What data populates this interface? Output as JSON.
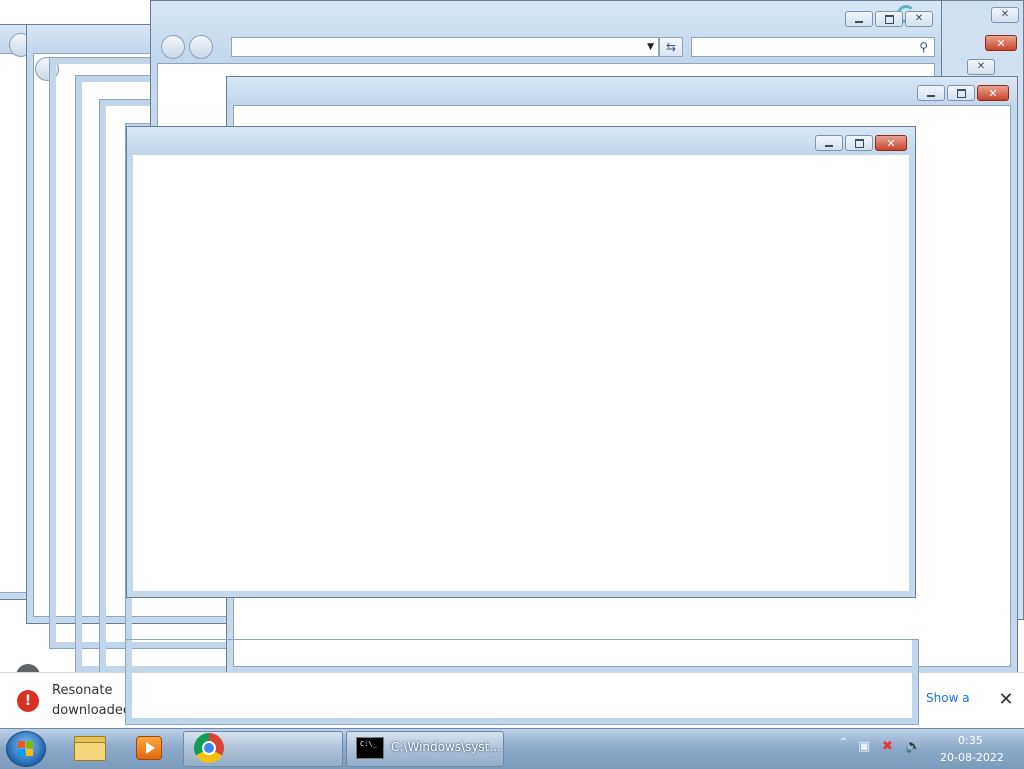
{
  "desktop": {
    "windows": [
      {
        "id": "back-explorer",
        "caption_buttons": [
          "minimize",
          "maximize",
          "close"
        ]
      },
      {
        "id": "explorer-main",
        "caption_buttons": [
          "minimize",
          "maximize",
          "close"
        ],
        "address_value": "",
        "search_value": ""
      },
      {
        "id": "front-window",
        "caption_buttons": [
          "minimize",
          "maximize",
          "close"
        ]
      },
      {
        "id": "dialog-window",
        "caption_buttons": [
          "minimize",
          "maximize",
          "close"
        ]
      }
    ],
    "glyphs": {
      "minimize": "",
      "maximize": "",
      "close": "✕"
    }
  },
  "download_bar": {
    "error_icon": "!",
    "line1": "Resonate",
    "line2": "downloaded",
    "show_all": "Show a",
    "close": "✕"
  },
  "taskbar": {
    "start": "start-orb",
    "pinned": [
      {
        "name": "Windows Explorer",
        "icon": "folder-icon"
      },
      {
        "name": "Media Player",
        "icon": "media-player-icon"
      },
      {
        "name": "Google Chrome",
        "icon": "chrome-icon"
      }
    ],
    "running": {
      "label": "C:\\Windows\\syst...",
      "icon": "cmd-icon",
      "icon_text": "C:\\_"
    },
    "tray": {
      "show_hidden": "⌃",
      "icons": [
        "action-center-icon",
        "network-icon",
        "volume-icon"
      ]
    },
    "clock": {
      "time": "0:35",
      "date": "20-08-2022"
    }
  }
}
